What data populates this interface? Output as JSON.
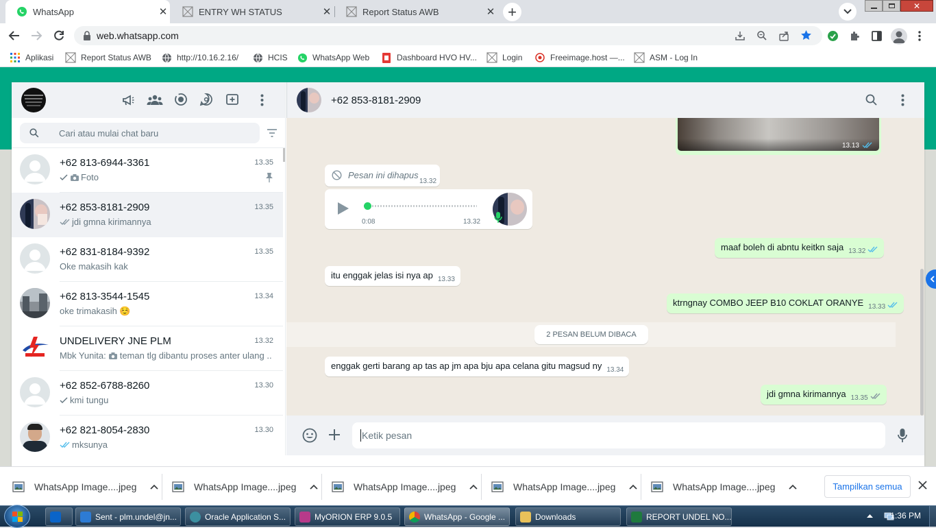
{
  "browser": {
    "tabs": [
      {
        "title": "WhatsApp",
        "active": true
      },
      {
        "title": "ENTRY WH STATUS",
        "active": false
      },
      {
        "title": "Report Status AWB",
        "active": false
      }
    ],
    "url": "web.whatsapp.com",
    "bookmarks": [
      "Aplikasi",
      "Report Status AWB",
      "http://10.16.2.16/",
      "HCIS",
      "WhatsApp Web",
      "Dashboard HVO HV...",
      "Login",
      "Freeimage.host —...",
      "ASM - Log In"
    ]
  },
  "sidebar": {
    "search_placeholder": "Cari atau mulai chat baru",
    "chats": [
      {
        "name": "+62 813-6944-3361",
        "time": "13.35",
        "preview": "Foto",
        "status": "sent",
        "pinned": true,
        "avatar": "default"
      },
      {
        "name": "+62 853-8181-2909",
        "time": "13.35",
        "preview": "jdi gmna kirimannya",
        "status": "delivered",
        "avatar": "photo"
      },
      {
        "name": "+62 831-8184-9392",
        "time": "13.35",
        "preview": "Oke makasih kak",
        "avatar": "default"
      },
      {
        "name": "+62 813-3544-1545",
        "time": "13.34",
        "preview": "oke trimakasih ☺️",
        "avatar": "photo-city"
      },
      {
        "name": "UNDELIVERY JNE PLM",
        "time": "13.32",
        "preview_sender": "Mbk Yunita:",
        "preview": "teman tlg dibantu proses anter ulang ...",
        "avatar": "jne-logo"
      },
      {
        "name": "+62 852-6788-8260",
        "time": "13.30",
        "preview": "kmi tungu",
        "status": "sent",
        "avatar": "default"
      },
      {
        "name": "+62 821-8054-2830",
        "time": "13.30",
        "preview": "mksunya",
        "status": "read",
        "avatar": "photo-man"
      }
    ]
  },
  "conversation": {
    "contact": "+62 853-8181-2909",
    "image_time": "13.13",
    "messages": [
      {
        "dir": "in",
        "type": "deleted",
        "text": "Pesan ini dihapus",
        "time": "13.32"
      },
      {
        "dir": "in",
        "type": "voice",
        "duration": "0:08",
        "time": "13.32"
      },
      {
        "dir": "out",
        "text": "maaf boleh di abntu keitkn   saja",
        "time": "13.32"
      },
      {
        "dir": "in",
        "text": "itu enggak jelas isi nya ap",
        "time": "13.33"
      },
      {
        "dir": "out",
        "text": "ktrngnay COMBO JEEP B10 COKLAT ORANYE",
        "time": "13.33"
      },
      {
        "dir": "in",
        "text": "enggak gerti barang ap tas ap jm apa bju apa celana gitu magsud ny",
        "time": "13.34"
      },
      {
        "dir": "out",
        "text": "jdi gmna kirimannya",
        "time": "13.35"
      }
    ],
    "unread_divider": "2 PESAN BELUM DIBACA",
    "composer_placeholder": "Ketik pesan"
  },
  "downloads": {
    "items": [
      "WhatsApp Image....jpeg",
      "WhatsApp Image....jpeg",
      "WhatsApp Image....jpeg",
      "WhatsApp Image....jpeg",
      "WhatsApp Image....jpeg"
    ],
    "show_all": "Tampilkan semua"
  },
  "taskbar": {
    "items": [
      "Sent - plm.undel@jn...",
      "Oracle Application S...",
      "MyORION ERP 9.0.5",
      "WhatsApp - Google ...",
      "Downloads",
      "REPORT UNDEL NO..."
    ],
    "clock": "1:36 PM"
  },
  "colors": {
    "wa_green": "#00a884",
    "out_bubble": "#d9fdd3",
    "tick_blue": "#53bdeb"
  }
}
